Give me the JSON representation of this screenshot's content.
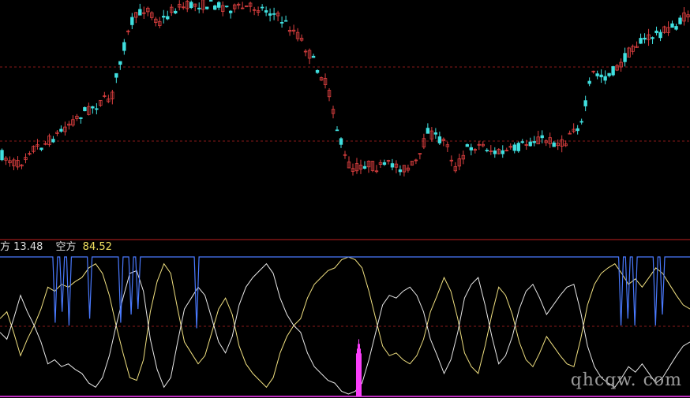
{
  "legend": {
    "item1_label": "方",
    "item1_value": "13.48",
    "item2_label": "空方",
    "item2_value": "84.52"
  },
  "watermark": "qhcqw. com",
  "colors": {
    "background": "#000000",
    "up_candle": "#e04040",
    "down_candle": "#40e0e0",
    "grid": "#8a1a1a",
    "divider": "#c02020",
    "bull_line": "#f0e080",
    "bear_line": "#e8e8e8",
    "signal_line": "#4a7aff",
    "spike": "#ff40ff"
  },
  "chart_data": [
    {
      "type": "candlestick",
      "title": "",
      "grid": "dashed horizontal",
      "close_path": [
        [
          0,
          0.73
        ],
        [
          0.025,
          0.78
        ],
        [
          0.04,
          0.7
        ],
        [
          0.06,
          0.68
        ],
        [
          0.08,
          0.63
        ],
        [
          0.1,
          0.57
        ],
        [
          0.12,
          0.52
        ],
        [
          0.14,
          0.48
        ],
        [
          0.16,
          0.45
        ],
        [
          0.175,
          0.23
        ],
        [
          0.19,
          0.08
        ],
        [
          0.21,
          0.01
        ],
        [
          0.23,
          0.09
        ],
        [
          0.25,
          0.02
        ],
        [
          0.28,
          0.0
        ],
        [
          0.31,
          0.0
        ],
        [
          0.34,
          0.02
        ],
        [
          0.37,
          0.01
        ],
        [
          0.39,
          0.03
        ],
        [
          0.41,
          0.08
        ],
        [
          0.43,
          0.14
        ],
        [
          0.45,
          0.25
        ],
        [
          0.47,
          0.37
        ],
        [
          0.48,
          0.46
        ],
        [
          0.49,
          0.62
        ],
        [
          0.5,
          0.74
        ],
        [
          0.51,
          0.8
        ],
        [
          0.53,
          0.77
        ],
        [
          0.55,
          0.79
        ],
        [
          0.57,
          0.77
        ],
        [
          0.59,
          0.8
        ],
        [
          0.61,
          0.74
        ],
        [
          0.62,
          0.6
        ],
        [
          0.63,
          0.64
        ],
        [
          0.65,
          0.67
        ],
        [
          0.66,
          0.8
        ],
        [
          0.68,
          0.69
        ],
        [
          0.7,
          0.68
        ],
        [
          0.72,
          0.72
        ],
        [
          0.74,
          0.71
        ],
        [
          0.76,
          0.68
        ],
        [
          0.78,
          0.65
        ],
        [
          0.8,
          0.66
        ],
        [
          0.82,
          0.68
        ],
        [
          0.83,
          0.6
        ],
        [
          0.845,
          0.58
        ],
        [
          0.86,
          0.33
        ],
        [
          0.88,
          0.35
        ],
        [
          0.9,
          0.3
        ],
        [
          0.92,
          0.2
        ],
        [
          0.95,
          0.15
        ],
        [
          0.97,
          0.12
        ],
        [
          0.985,
          0.1
        ],
        [
          1.0,
          0.04
        ]
      ]
    },
    {
      "type": "line",
      "title": "",
      "grid": "dashed horizontal",
      "series": [
        {
          "name": "方",
          "last": 13.48,
          "values": [
            55,
            60,
            45,
            28,
            40,
            50,
            62,
            78,
            75,
            80,
            78,
            82,
            85,
            92,
            95,
            88,
            72,
            50,
            30,
            12,
            10,
            25,
            60,
            82,
            95,
            88,
            62,
            38,
            30,
            22,
            28,
            45,
            62,
            70,
            58,
            35,
            22,
            15,
            10,
            5,
            12,
            30,
            42,
            50,
            55,
            70,
            80,
            85,
            90,
            92,
            98,
            100,
            98,
            92,
            75,
            55,
            35,
            28,
            30,
            25,
            22,
            28,
            40,
            60,
            72,
            85,
            75,
            55,
            30,
            20,
            15,
            35,
            58,
            78,
            72,
            58,
            38,
            25,
            20,
            30,
            42,
            35,
            28,
            22,
            20,
            40,
            65,
            80,
            88,
            92,
            95,
            88,
            80,
            84,
            78,
            85,
            92,
            88,
            80,
            72,
            65,
            62
          ]
        },
        {
          "name": "空方",
          "last": 84.52,
          "values": [
            45,
            40,
            55,
            72,
            60,
            50,
            38,
            22,
            25,
            20,
            22,
            18,
            15,
            8,
            5,
            12,
            28,
            50,
            70,
            88,
            90,
            75,
            40,
            18,
            5,
            12,
            38,
            62,
            70,
            78,
            72,
            55,
            38,
            30,
            42,
            65,
            78,
            85,
            90,
            95,
            88,
            70,
            58,
            50,
            45,
            30,
            20,
            15,
            10,
            8,
            2,
            0,
            2,
            8,
            25,
            45,
            65,
            72,
            70,
            75,
            78,
            72,
            60,
            40,
            28,
            15,
            25,
            45,
            70,
            80,
            85,
            65,
            42,
            22,
            28,
            42,
            62,
            75,
            80,
            70,
            58,
            65,
            72,
            78,
            80,
            60,
            35,
            20,
            12,
            8,
            5,
            12,
            20,
            16,
            22,
            15,
            8,
            12,
            20,
            28,
            35,
            38
          ]
        },
        {
          "name": "",
          "values": [
            100,
            100,
            100,
            100,
            100,
            100,
            100,
            100,
            100,
            100,
            100,
            100,
            100,
            100,
            100,
            100,
            100,
            100,
            100,
            100,
            100,
            100,
            100,
            100,
            100,
            100,
            100,
            100,
            100,
            100,
            100,
            100,
            100,
            100,
            100,
            100,
            100,
            100,
            100,
            100,
            100,
            100,
            100,
            100,
            100,
            100,
            100,
            100,
            100,
            100,
            100,
            100,
            100,
            100,
            100,
            100,
            100,
            100,
            100,
            100,
            100,
            100,
            100,
            100,
            100,
            100,
            100,
            100,
            100,
            100,
            100,
            100,
            100,
            100,
            100,
            100,
            100,
            100,
            100,
            100,
            100,
            100,
            100,
            100,
            100,
            100,
            100,
            100,
            100,
            100,
            100,
            100,
            100,
            100,
            100,
            100,
            100,
            100,
            100,
            100,
            100,
            100
          ],
          "dips": [
            {
              "x": 0.08,
              "value": 52
            },
            {
              "x": 0.09,
              "value": 60
            },
            {
              "x": 0.1,
              "value": 50
            },
            {
              "x": 0.13,
              "value": 55
            },
            {
              "x": 0.175,
              "value": 52
            },
            {
              "x": 0.19,
              "value": 58
            },
            {
              "x": 0.2,
              "value": 62
            },
            {
              "x": 0.285,
              "value": 48
            },
            {
              "x": 0.9,
              "value": 50
            },
            {
              "x": 0.91,
              "value": 55
            },
            {
              "x": 0.92,
              "value": 50
            },
            {
              "x": 0.95,
              "value": 50
            },
            {
              "x": 0.96,
              "value": 58
            }
          ]
        }
      ],
      "reference_lines": [
        100,
        50,
        0
      ],
      "spike": {
        "x": 0.52,
        "value": 40
      }
    }
  ]
}
